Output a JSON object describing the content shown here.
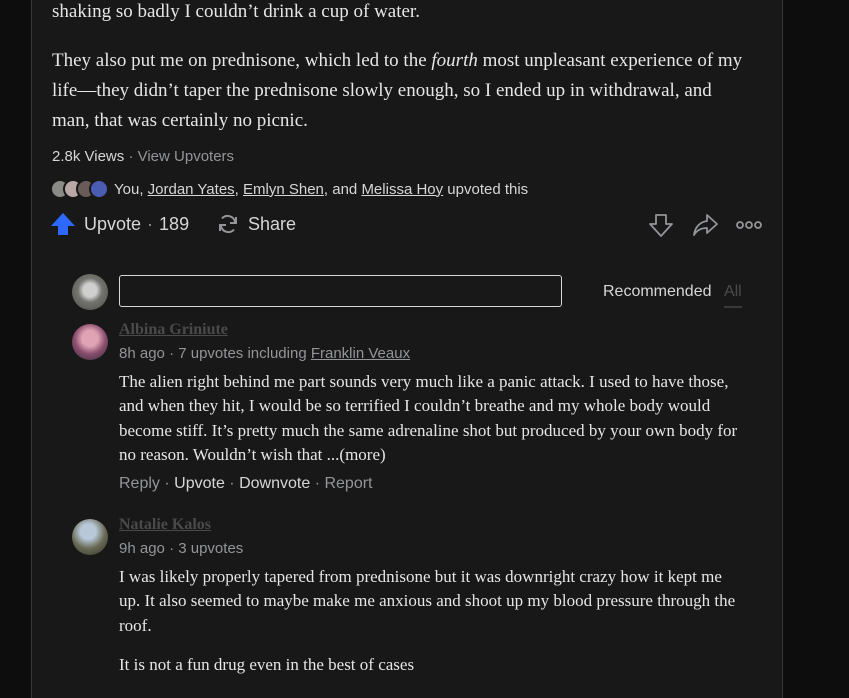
{
  "answer": {
    "line_top": "shaking so badly I couldn’t drink a cup of water.",
    "para2_before": "They also put me on prednisone, which led to the ",
    "para2_italic": "fourth",
    "para2_after": " most unpleasant experience of my life—they didn’t taper the prednisone slowly enough, so I ended up in withdrawal, and man, that was certainly no picnic."
  },
  "stats": {
    "views": "2.8k Views",
    "separator": "·",
    "view_upvoters": "View Upvoters"
  },
  "upvoters": {
    "you": "You,",
    "names": [
      "Jordan Yates",
      "Emlyn Shen",
      "Melissa Hoy"
    ],
    "comma": ",",
    "and": ", and",
    "suffix": "upvoted this"
  },
  "actions": {
    "upvote_label": "Upvote",
    "separator": "·",
    "upvote_count": "189",
    "share_label": "Share",
    "upvote_color": "#2e69ff"
  },
  "comments_section": {
    "input_value": "",
    "sort_recommended": "Recommended",
    "sort_all": "All"
  },
  "comments": [
    {
      "author": "Albina Griniute",
      "time": "8h ago",
      "upvotes": "7 upvotes including",
      "upvoter": "Franklin Veaux",
      "body": [
        "The alien right behind me part sounds very much like a panic attack. I used to have those, and when they hit, I would be so terrified I couldn’t breathe and my whole body would become stiff. It’s pretty much the same adrenaline shot but produced by your own body for no reason. Wouldn’t wish that ..."
      ],
      "more": "(more)",
      "reply": "Reply",
      "upvote": "Upvote",
      "downvote": "Downvote",
      "report": "Report"
    },
    {
      "author": "Natalie Kalos",
      "time": "9h ago",
      "upvotes": "3 upvotes",
      "body": [
        "I was likely properly tapered from prednisone but it was downright crazy how it kept me up. It also seemed to maybe make me anxious and shoot up my blood pressure through the roof.",
        "It is not a fun drug even in the best of cases"
      ]
    }
  ],
  "icons": {
    "upvote": "upvote-arrow-icon",
    "share": "share-cycle-icon",
    "downvote": "downvote-arrow-icon",
    "forward": "forward-arrow-icon",
    "more": "more-dots-icon"
  }
}
